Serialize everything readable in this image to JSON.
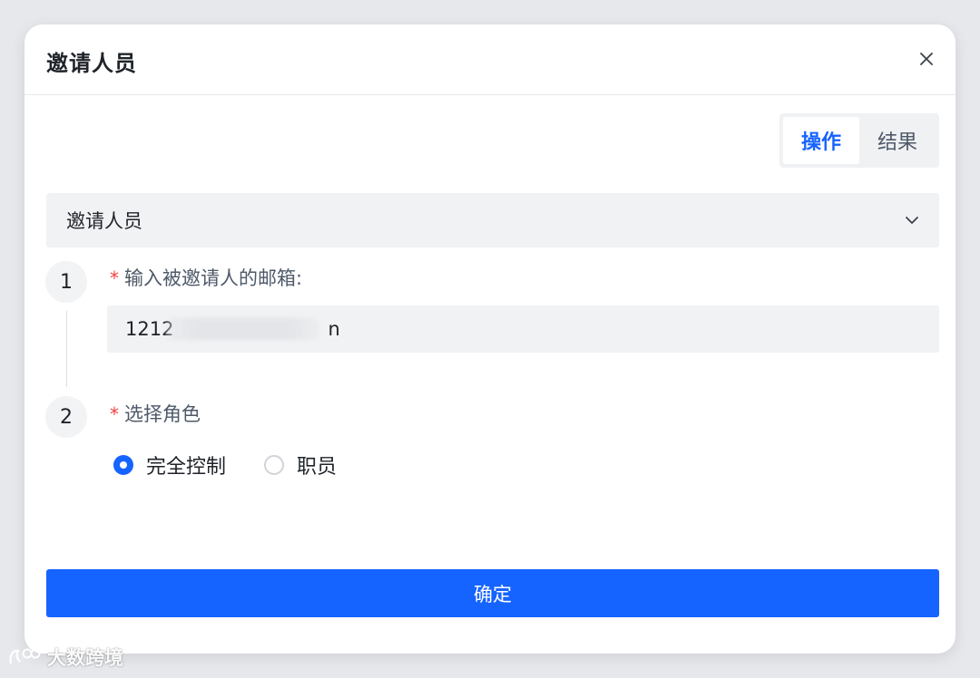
{
  "dialog": {
    "title": "邀请人员",
    "close_icon": "close-icon"
  },
  "segmented": {
    "items": [
      {
        "label": "操作",
        "active": true
      },
      {
        "label": "结果",
        "active": false
      }
    ]
  },
  "collapse": {
    "label": "邀请人员",
    "icon": "chevron-down-icon"
  },
  "steps": [
    {
      "number": "1",
      "required_mark": "*",
      "label": "输入被邀请人的邮箱:"
    },
    {
      "number": "2",
      "required_mark": "*",
      "label": "选择角色"
    }
  ],
  "email": {
    "value_prefix": "1212",
    "value_suffix": "n"
  },
  "roles": [
    {
      "label": "完全控制",
      "checked": true
    },
    {
      "label": "职员",
      "checked": false
    }
  ],
  "confirm_label": "确定",
  "watermark": "大数跨境",
  "colors": {
    "primary": "#1664ff",
    "required": "#f53f3f"
  }
}
